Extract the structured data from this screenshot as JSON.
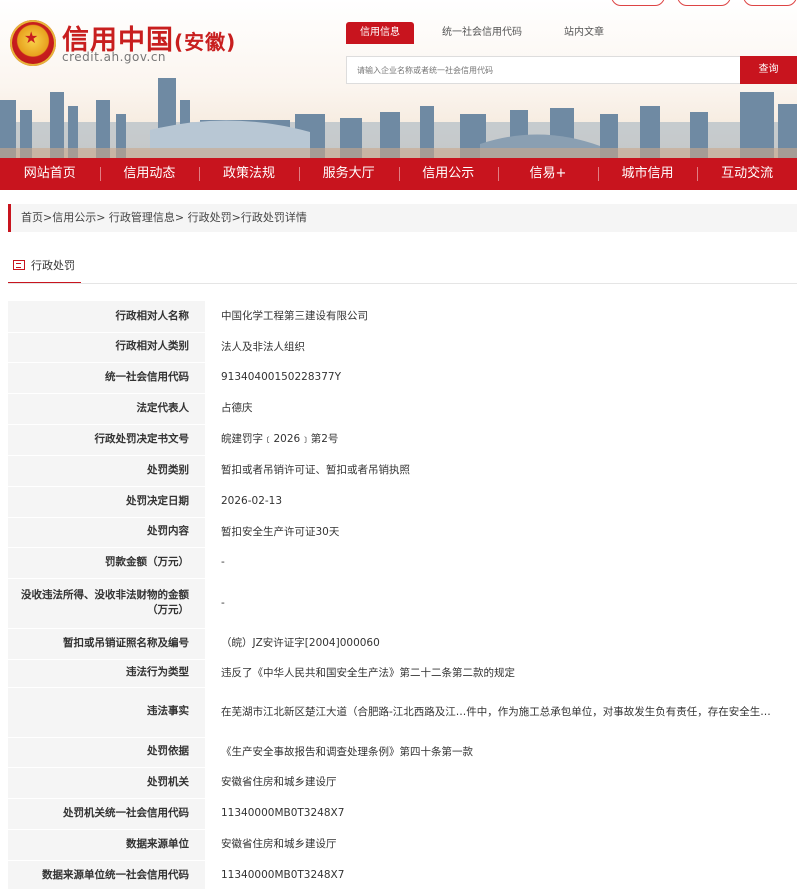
{
  "header": {
    "site_title": "信用中国",
    "province": "(安徽)",
    "url": "credit.ah.gov.cn",
    "tabs": [
      "信用信息",
      "统一社会信用代码",
      "站内文章"
    ],
    "search_placeholder": "请输入企业名称或者统一社会信用代码",
    "search_button": "查询"
  },
  "nav": [
    "网站首页",
    "信用动态",
    "政策法规",
    "服务大厅",
    "信用公示",
    "信易+",
    "城市信用",
    "互动交流"
  ],
  "breadcrumb": "首页>信用公示> 行政管理信息> 行政处罚>行政处罚详情",
  "section_title": "行政处罚",
  "rows": [
    {
      "label": "行政相对人名称",
      "value": "中国化学工程第三建设有限公司"
    },
    {
      "label": "行政相对人类别",
      "value": "法人及非法人组织"
    },
    {
      "label": "统一社会信用代码",
      "value": "91340400150228377Y"
    },
    {
      "label": "法定代表人",
      "value": "占德庆"
    },
    {
      "label": "行政处罚决定书文号",
      "value": "皖建罚字﹝2026﹞第2号"
    },
    {
      "label": "处罚类别",
      "value": "暂扣或者吊销许可证、暂扣或者吊销执照"
    },
    {
      "label": "处罚决定日期",
      "value": "2026-02-13"
    },
    {
      "label": "处罚内容",
      "value": "暂扣安全生产许可证30天"
    },
    {
      "label": "罚款金额（万元）",
      "value": "-"
    },
    {
      "label": "没收违法所得、没收非法财物的金额（万元）",
      "value": "-"
    },
    {
      "label": "暂扣或吊销证照名称及编号",
      "value": "（皖）JZ安许证字[2004]000060"
    },
    {
      "label": "违法行为类型",
      "value": "违反了《中华人民共和国安全生产法》第二十二条第二款的规定"
    },
    {
      "label": "违法事实",
      "value": "在芜湖市江北新区楚江大道（合肥路-江北西路及江…件中，作为施工总承包单位，对事故发生负有责任，存在安全生…"
    },
    {
      "label": "处罚依据",
      "value": "《生产安全事故报告和调查处理条例》第四十条第一款"
    },
    {
      "label": "处罚机关",
      "value": "安徽省住房和城乡建设厅"
    },
    {
      "label": "处罚机关统一社会信用代码",
      "value": "11340000MB0T3248X7"
    },
    {
      "label": "数据来源单位",
      "value": "安徽省住房和城乡建设厅"
    },
    {
      "label": "数据来源单位统一社会信用代码",
      "value": "11340000MB0T3248X7"
    }
  ]
}
